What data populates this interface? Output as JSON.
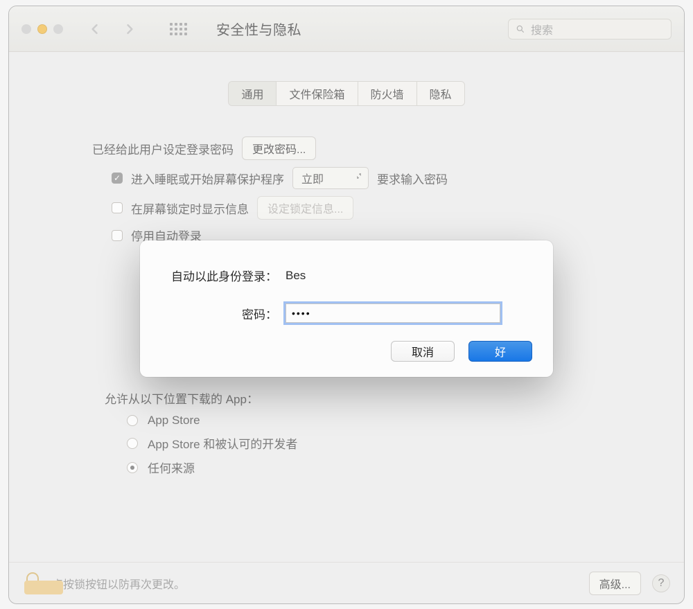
{
  "window": {
    "title": "安全性与隐私",
    "search_placeholder": "搜索",
    "tabs": [
      "通用",
      "文件保险箱",
      "防火墙",
      "隐私"
    ],
    "active_tab_index": 0
  },
  "general": {
    "login_password_set_label": "已经给此用户设定登录密码",
    "change_password_label": "更改密码...",
    "require_password_label_left": "进入睡眠或开始屏幕保护程序",
    "require_password_delay": "立即",
    "require_password_label_right": "要求输入密码",
    "show_message_label": "在屏幕锁定时显示信息",
    "set_lock_message_label": "设定锁定信息...",
    "disable_autologin_label": "停用自动登录"
  },
  "allow_apps": {
    "heading": "允许从以下位置下载的 App：",
    "options": [
      "App Store",
      "App Store 和被认可的开发者",
      "任何来源"
    ],
    "selected_index": 2
  },
  "lockbar": {
    "text": "点按锁按钮以防再次更改。",
    "advanced_label": "高级..."
  },
  "dialog": {
    "autologin_label": "自动以此身份登录：",
    "autologin_user": "Bes",
    "password_label": "密码：",
    "password_value": "••••",
    "cancel": "取消",
    "ok": "好"
  }
}
